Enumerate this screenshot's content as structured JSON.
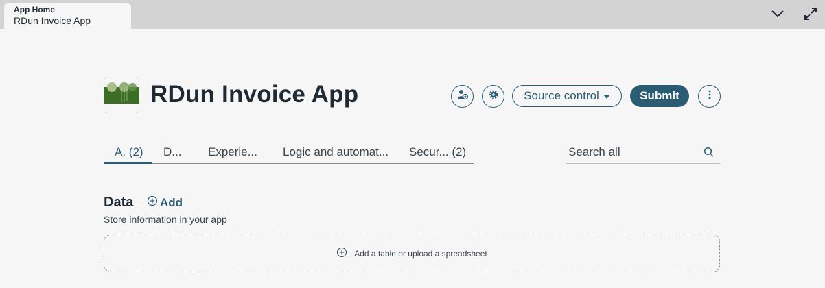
{
  "tab_strip": {
    "breadcrumb": "App Home",
    "app_name": "RDun Invoice App",
    "icons": [
      "chevron-down-icon",
      "expand-icon"
    ]
  },
  "header": {
    "title": "RDun Invoice App",
    "logo": "app-logo-green-nature",
    "source_control_label": "Source control",
    "submit_label": "Submit",
    "icons": [
      "add-user-icon",
      "gear-icon",
      "more-vertical-icon"
    ]
  },
  "tabs": [
    {
      "label": "A. (2)",
      "active": true
    },
    {
      "label": "D..."
    },
    {
      "label": "Experie..."
    },
    {
      "label": "Logic and automat..."
    },
    {
      "label": "Secur... (2)"
    }
  ],
  "search": {
    "placeholder": "Search all",
    "icon": "search-icon"
  },
  "data_section": {
    "title": "Data",
    "add_label": "Add",
    "subtitle": "Store information in your app",
    "dropzone_label": "Add a table or upload a spreadsheet"
  },
  "colors": {
    "accent": "#2b5c73",
    "background": "#f5f6f5",
    "topbar": "#d3d3d3",
    "text": "#1f2a33"
  }
}
